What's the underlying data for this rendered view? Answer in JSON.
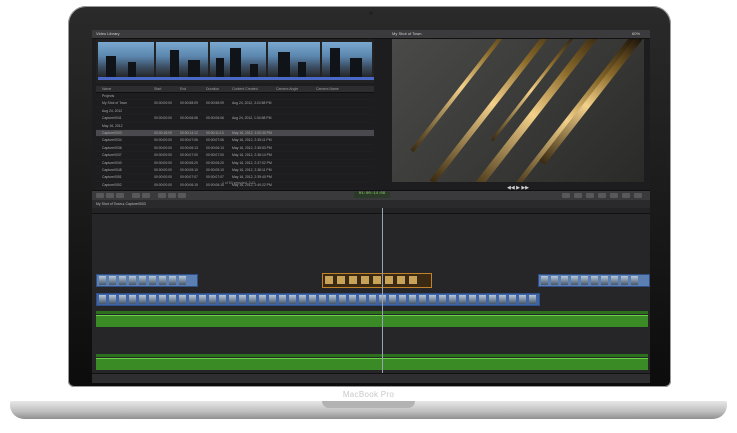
{
  "device": {
    "label": "MacBook Pro"
  },
  "app": {
    "library_title": "Video Library",
    "viewer_title": "My Shot of Town",
    "zoom_label": "60%",
    "list_headers": [
      "Name",
      "Start",
      "End",
      "Duration",
      "Content Created",
      "Camera Angle",
      "Camera Name"
    ],
    "rows": [
      {
        "name": "Projects",
        "start": "",
        "end": "",
        "dur": "",
        "created": "",
        "sel": false
      },
      {
        "name": "My Shot of Town",
        "start": "00:00:00:00",
        "end": "00:00:58:09",
        "dur": "00:00:58:09",
        "created": "Aug 24, 2012, 3:24:58 PM",
        "sel": false
      },
      {
        "name": "Aug 24, 2012",
        "start": "",
        "end": "",
        "dur": "",
        "created": "",
        "sel": false
      },
      {
        "name": "Capture0041",
        "start": "00:00:00:00",
        "end": "00:00:06:06",
        "dur": "00:00:06:06",
        "created": "Aug 24, 2012, 1:34:58 PM",
        "sel": false
      },
      {
        "name": "May 16, 2012",
        "start": "",
        "end": "",
        "dur": "",
        "created": "",
        "sel": false
      },
      {
        "name": "Capture0003",
        "start": "00:00:18:09",
        "end": "00:00:14:12",
        "dur": "00:00:11:13",
        "created": "May 16, 2012, 1:00:30 PM",
        "sel": true
      },
      {
        "name": "Capture0034",
        "start": "00:00:00:00",
        "end": "00:00:07:06",
        "dur": "00:00:07:06",
        "created": "May 16, 2012, 2:35:11 PM",
        "sel": false
      },
      {
        "name": "Capture0036",
        "start": "00:00:00:00",
        "end": "00:00:06:13",
        "dur": "00:00:06:13",
        "created": "May 16, 2012, 2:35:53 PM",
        "sel": false
      },
      {
        "name": "Capture0037",
        "start": "00:00:00:00",
        "end": "00:00:07:00",
        "dur": "00:00:07:00",
        "created": "May 16, 2012, 2:36:14 PM",
        "sel": false
      },
      {
        "name": "Capture0040",
        "start": "00:00:00:00",
        "end": "00:00:06:20",
        "dur": "00:00:06:20",
        "created": "May 16, 2012, 2:37:02 PM",
        "sel": false
      },
      {
        "name": "Capture0048",
        "start": "00:00:00:00",
        "end": "00:00:05:10",
        "dur": "00:00:05:10",
        "created": "May 16, 2012, 2:38:11 PM",
        "sel": false
      },
      {
        "name": "Capture0051",
        "start": "00:00:00:00",
        "end": "00:00:07:07",
        "dur": "00:00:07:07",
        "created": "May 16, 2012, 2:39:40 PM",
        "sel": false
      },
      {
        "name": "Capture0052",
        "start": "00:00:00:00",
        "end": "00:00:06:15",
        "dur": "00:00:06:15",
        "created": "May 16, 2012, 2:40:22 PM",
        "sel": false
      },
      {
        "name": "Capture0053",
        "start": "00:00:00:00",
        "end": "00:00:06:01",
        "dur": "00:00:06:01",
        "created": "May 16, 2012, 2:41:03 PM",
        "sel": false
      },
      {
        "name": "Capture0054",
        "start": "00:00:00:00",
        "end": "00:00:05:22",
        "dur": "00:00:05:22",
        "created": "May 16, 2012, 2:41:48 PM",
        "sel": false
      },
      {
        "name": "Capture0056",
        "start": "00:00:00:00",
        "end": "00:00:06:09",
        "dur": "00:00:06:09",
        "created": "May 16, 2012, 2:42:30 PM",
        "sel": false
      }
    ],
    "list_footer": "1 of 60 selected, 3:41",
    "timecode": "01:00:14:09",
    "project_name": "My Shot of Town",
    "clip_name": "Capture0003"
  }
}
